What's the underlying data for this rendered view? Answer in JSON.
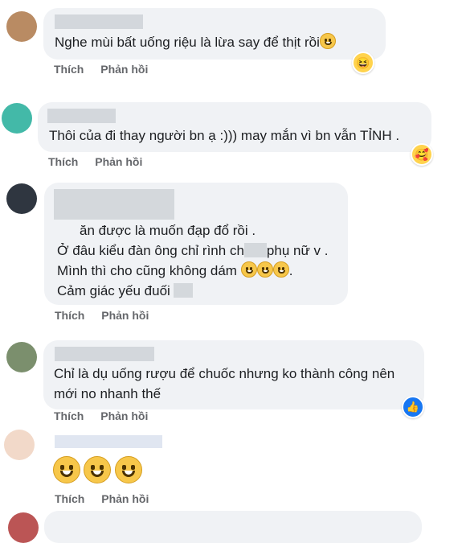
{
  "comments": [
    {
      "text_lines": [
        "Nghe mùi bất uống riệu là lừa say để thịt rồi"
      ],
      "actions": {
        "like": "Thích",
        "reply": "Phản hồi"
      },
      "reaction": "haha-icon"
    },
    {
      "text_lines": [
        "Thôi của đi thay người bn ạ :))) may mắn vì bn vẫn TỈNH ."
      ],
      "actions": {
        "like": "Thích",
        "reply": "Phản hồi"
      },
      "reaction": "care-icon"
    },
    {
      "text_lines": [
        "ăn được là muốn đạp đổ rồi .",
        "Ở đâu kiểu đàn ông chỉ rình ch",
        "phụ nữ v .",
        "Mình thì cho cũng không dám",
        ".",
        "Cảm giác yếu đuối"
      ],
      "actions": {
        "like": "Thích",
        "reply": "Phản hồi"
      }
    },
    {
      "text_lines": [
        "Chỉ là dụ uống rượu để chuốc nhưng ko thành công nên",
        "mới no nhanh thế"
      ],
      "actions": {
        "like": "Thích",
        "reply": "Phản hồi"
      },
      "reaction": "like-icon"
    },
    {
      "actions": {
        "like": "Thích",
        "reply": "Phản hồi"
      }
    }
  ],
  "colors": {
    "bubble": "#f0f2f5",
    "action_text": "#65676b",
    "like_blue": "#1877f2"
  }
}
